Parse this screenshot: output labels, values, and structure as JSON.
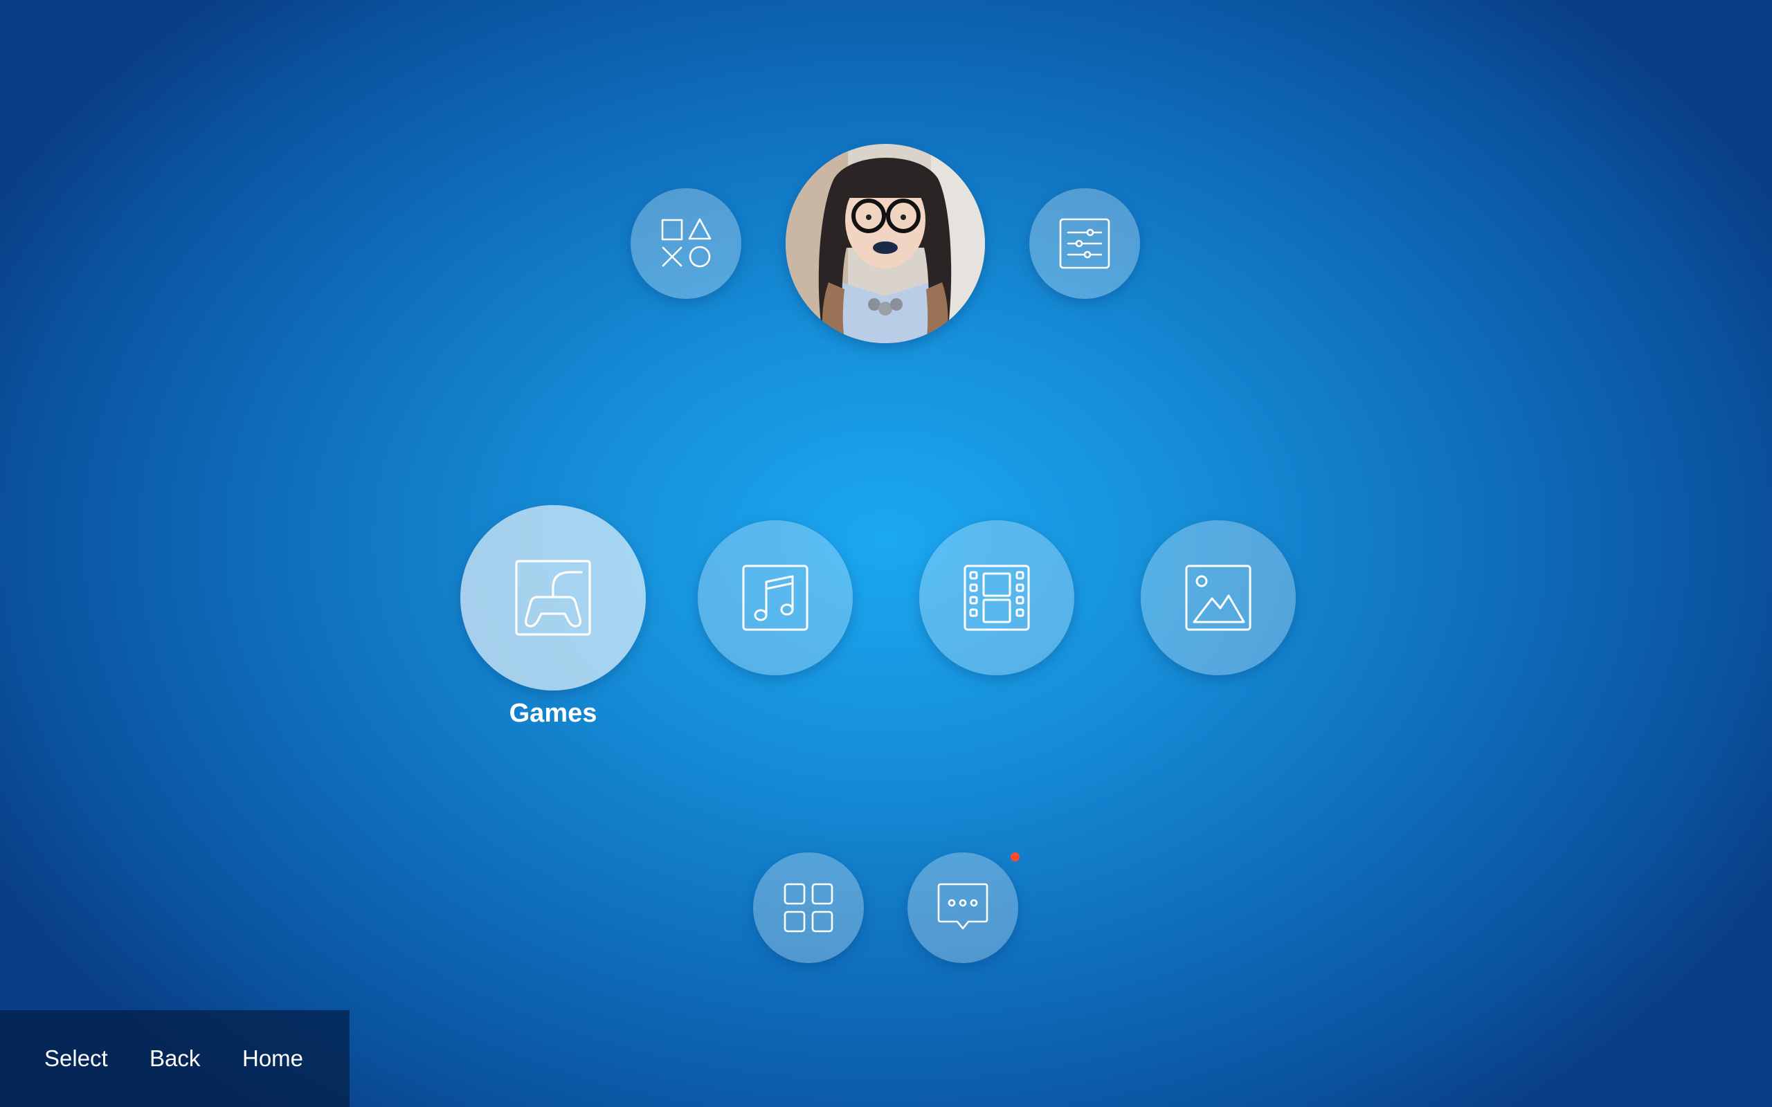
{
  "top_row": {
    "left_icon": "playstation-shapes-icon",
    "right_icon": "settings-sliders-icon",
    "avatar_icon": "user-avatar-photo"
  },
  "categories": [
    {
      "label": "Games",
      "icon": "gamepad-icon",
      "selected": true
    },
    {
      "label": "",
      "icon": "music-note-icon",
      "selected": false
    },
    {
      "label": "",
      "icon": "film-icon",
      "selected": false
    },
    {
      "label": "",
      "icon": "image-icon",
      "selected": false
    }
  ],
  "bottom_row": {
    "apps_icon": "apps-grid-icon",
    "messages_icon": "chat-bubble-icon",
    "messages_has_notification": true
  },
  "footer": {
    "select_label": "Select",
    "back_label": "Back",
    "home_label": "Home"
  },
  "colors": {
    "background_center": "#1ba8f2",
    "background_edge": "#093f86",
    "notification_dot": "#ff4a2a",
    "footer_bar": "#041e46"
  }
}
